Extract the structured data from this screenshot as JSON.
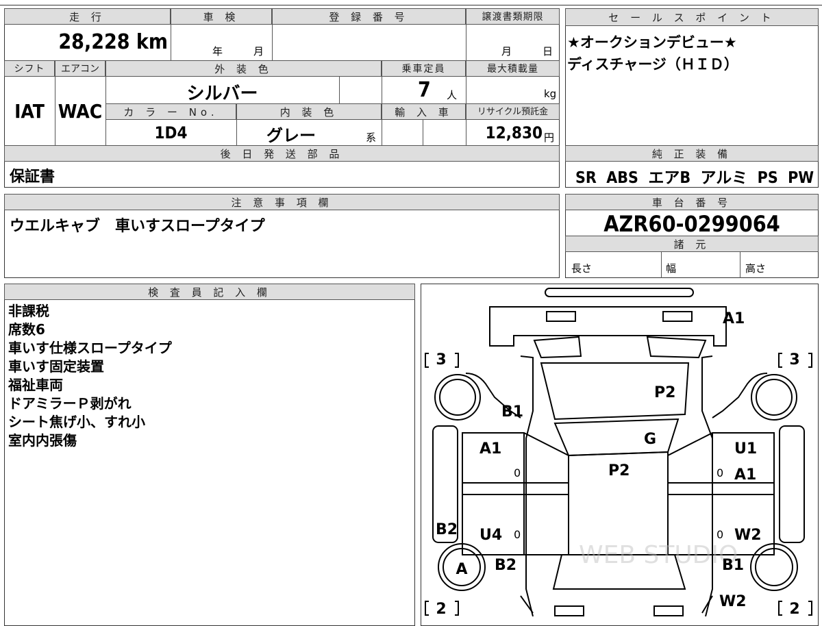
{
  "vehicle": {
    "headers": {
      "mileage": "走 行",
      "inspection": "車 検",
      "registration_no": "登 録 番 号",
      "transfer_deadline": "譲渡書類期限",
      "shift": "シフト",
      "aircon": "エアコン",
      "exterior_color": "外 装 色",
      "capacity": "乗車定員",
      "max_load": "最大積載量",
      "color_no": "カ ラ ー No.",
      "interior_color": "内 装 色",
      "import": "輸 入 車",
      "recycle_fee": "リサイクル預託金",
      "later_parts": "後 日 発 送 部 品"
    },
    "mileage": "28,228 km",
    "inspection_year_unit": "年",
    "inspection_month_unit": "月",
    "transfer_month_unit": "月",
    "transfer_day_unit": "日",
    "shift": "IAT",
    "aircon": "WAC",
    "exterior_color": "シルバー",
    "capacity": "7",
    "capacity_unit": "人",
    "max_load_unit": "kg",
    "color_no": "1D4",
    "interior_color": "グレー",
    "interior_suffix": "系",
    "recycle_fee": "12,830",
    "recycle_unit": "円",
    "later_parts": "保証書"
  },
  "sales_points": {
    "header": "セ ー ル ス ポ イ ン ト",
    "lines": [
      "★オークションデビュー★",
      "ディスチャージ（ＨＩＤ）"
    ]
  },
  "equipment": {
    "header": "純 正 装 備",
    "items": "SR  ABS  エアB  アルミ  PS  PW"
  },
  "notes": {
    "header": "注 意 事 項 欄",
    "text": "ウエルキャブ　車いすスロープタイプ"
  },
  "chassis": {
    "header": "車 台 番 号",
    "number": "AZR60-0299064",
    "spec_header": "諸 元",
    "length": "長さ",
    "width": "幅",
    "height": "高さ"
  },
  "inspector": {
    "header": "検 査 員 記 入 欄",
    "lines": [
      "非課税",
      "席数6",
      "車いす仕様スロープタイプ",
      "車いす固定装置",
      "福祉車両",
      "ドアミラーＰ剥がれ",
      "シート焦げ小、すれ小",
      "室内内張傷"
    ]
  },
  "diagram": {
    "marks": {
      "front_bumper": "A1",
      "hood_left": "B1",
      "hood_right": "P2",
      "windshield": "G",
      "roof": "P2",
      "front_left_door": "A1",
      "front_right_door": "U1",
      "front_right_door2": "A1",
      "rear_left_panel": "B2",
      "rear_left_door": "U4",
      "rear_right_door": "W2",
      "rear_left_tire": "A",
      "rear_left_fender": "B2",
      "rear_right_fender": "B1",
      "rear_right_quarter": "W2"
    },
    "zeros": [
      "0",
      "0",
      "0",
      "0"
    ],
    "tire_depth": {
      "front_left": "3",
      "front_right": "3",
      "rear_left": "2",
      "rear_right": "2"
    },
    "watermark": "WEB STUDIO"
  }
}
